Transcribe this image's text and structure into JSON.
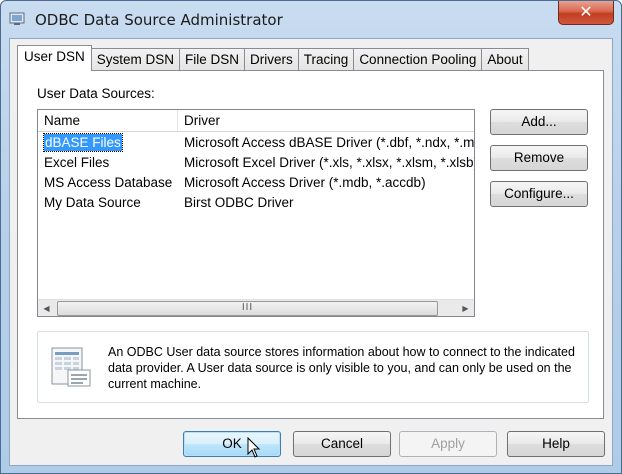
{
  "window": {
    "title": "ODBC Data Source Administrator",
    "close_glyph": "✕"
  },
  "tabs": [
    {
      "label": "User DSN",
      "active": true
    },
    {
      "label": "System DSN",
      "active": false
    },
    {
      "label": "File DSN",
      "active": false
    },
    {
      "label": "Drivers",
      "active": false
    },
    {
      "label": "Tracing",
      "active": false
    },
    {
      "label": "Connection Pooling",
      "active": false
    },
    {
      "label": "About",
      "active": false
    }
  ],
  "user_dsn": {
    "section_label": "User Data Sources:",
    "columns": {
      "name": "Name",
      "driver": "Driver"
    },
    "rows": [
      {
        "name": "dBASE Files",
        "driver": "Microsoft Access dBASE Driver (*.dbf, *.ndx, *.md",
        "selected": true
      },
      {
        "name": "Excel Files",
        "driver": "Microsoft Excel Driver (*.xls, *.xlsx, *.xlsm, *.xlsb)",
        "selected": false
      },
      {
        "name": "MS Access Database",
        "driver": "Microsoft Access Driver (*.mdb, *.accdb)",
        "selected": false
      },
      {
        "name": "My Data Source",
        "driver": "Birst ODBC Driver",
        "selected": false
      }
    ],
    "scroll_left": "◀",
    "scroll_right": "▶",
    "scroll_grip": "III",
    "buttons": {
      "add": "Add...",
      "remove": "Remove",
      "configure": "Configure..."
    },
    "info_text": "An ODBC User data source stores information about how to connect to the indicated data provider.  A User data source is only visible to you, and can only be used on the current machine."
  },
  "footer": {
    "ok": "OK",
    "cancel": "Cancel",
    "apply": "Apply",
    "help": "Help"
  },
  "colors": {
    "selection": "#3399ff",
    "title_bar": "#b9d1ea",
    "close_button": "#c13d22"
  }
}
